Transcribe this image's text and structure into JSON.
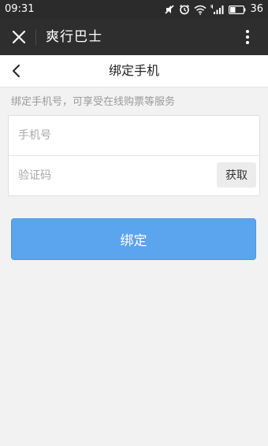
{
  "status_bar": {
    "time": "09:31",
    "battery": "36",
    "icons": [
      "mute-icon",
      "alarm-icon",
      "wifi-icon",
      "signal-4g-icon",
      "battery-icon"
    ]
  },
  "app_bar": {
    "title": "爽行巴士",
    "close_icon": "close-icon",
    "more_icon": "more-vertical-icon"
  },
  "page_header": {
    "title": "绑定手机",
    "back_icon": "chevron-left-icon"
  },
  "hint": "绑定手机号，可享受在线购票等服务",
  "form": {
    "phone_placeholder": "手机号",
    "phone_value": "",
    "code_placeholder": "验证码",
    "code_value": "",
    "get_code_label": "获取"
  },
  "bind_button_label": "绑定",
  "colors": {
    "status_bar_bg": "#2b2b2b",
    "app_bar_bg": "#2e2e2e",
    "page_bg": "#f2f2f2",
    "primary_button": "#5ba4ee"
  }
}
